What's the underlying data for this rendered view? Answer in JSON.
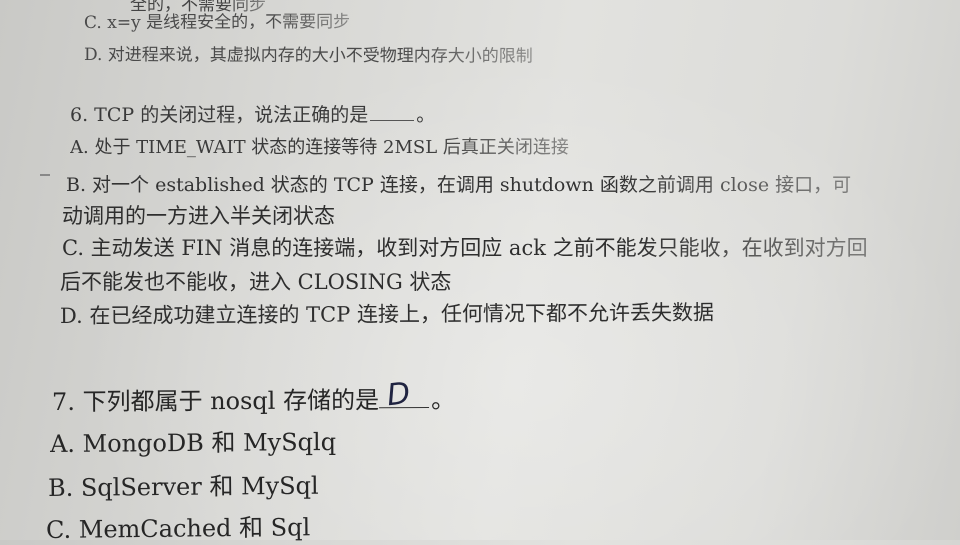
{
  "q5": {
    "top_fragment": "全的，不需要同步",
    "c": "C.  x=y 是线程安全的，不需要同步",
    "d": "D.  对进程来说，其虚拟内存的大小不受物理内存大小的限制"
  },
  "q6": {
    "stem_before": "6.  TCP 的关闭过程，说法正确的是",
    "stem_after": "。",
    "a": "A.  处于 TIME_WAIT 状态的连接等待 2MSL 后真正关闭连接",
    "b": "B.  对一个 established 状态的 TCP 连接，在调用 shutdown 函数之前调用 close 接口，可",
    "b_cont": "动调用的一方进入半关闭状态",
    "c": "C.  主动发送 FIN 消息的连接端，收到对方回应 ack 之前不能发只能收，在收到对方回",
    "c_cont": "后不能发也不能收，进入 CLOSING 状态",
    "d": "D.  在已经成功建立连接的 TCP 连接上，任何情况下都不允许丢失数据"
  },
  "q7": {
    "stem_before": "7.  下列都属于 nosql 存储的是",
    "answer": "D",
    "stem_after": "。",
    "a": "A.  MongoDB 和 MySqlq",
    "b": "B.  SqlServer 和 MySql",
    "c": "C.  MemCached 和 Sql"
  }
}
